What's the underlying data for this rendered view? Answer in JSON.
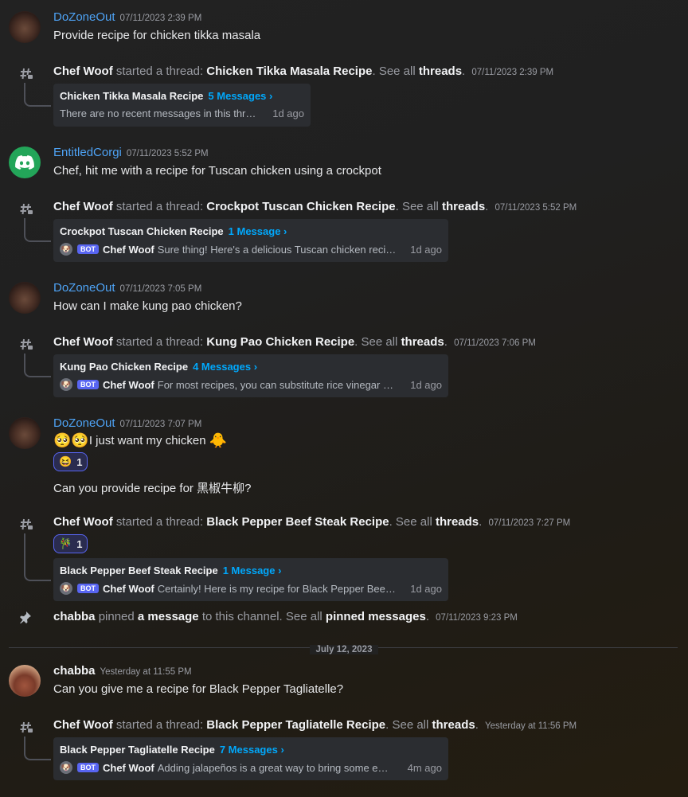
{
  "messages": [
    {
      "user": "DoZoneOut",
      "time": "07/11/2023 2:39 PM",
      "text": "Provide recipe for chicken tikka masala"
    },
    {
      "user": "EntitledCorgi",
      "time": "07/11/2023 5:52 PM",
      "text": "Chef, hit me with a recipe for Tuscan chicken using a crockpot"
    },
    {
      "user": "DoZoneOut",
      "time": "07/11/2023 7:05 PM",
      "text": "How can I make kung pao chicken?"
    },
    {
      "user": "DoZoneOut",
      "time": "07/11/2023 7:07 PM",
      "text": "I just want my chicken",
      "emoji_lead": "🥺🥺",
      "emoji_trail": "🐥",
      "reaction": {
        "emoji": "😆",
        "count": "1"
      },
      "text2": "Can you provide recipe for 黑椒牛柳?"
    },
    {
      "user": "chabba",
      "time": "Yesterday at 11:55 PM",
      "text": "Can you give me a recipe for Black Pepper Tagliatelle?"
    }
  ],
  "system": {
    "started": "started a thread:",
    "see_all": "See all",
    "threads_word": "threads",
    "pinned_verb": "pinned",
    "a_message": "a message",
    "to_channel": "to this channel. See all",
    "pinned_messages": "pinned messages",
    "bot_label": "BOT"
  },
  "threads": [
    {
      "starter": "Chef Woof",
      "name": "Chicken Tikka Masala Recipe",
      "time": "07/11/2023 2:39 PM",
      "count": "5 Messages ›",
      "preview_author": "",
      "preview": "There are no recent messages in this thread.",
      "ago": "1d ago"
    },
    {
      "starter": "Chef Woof",
      "name": "Crockpot Tuscan Chicken Recipe",
      "time": "07/11/2023 5:52 PM",
      "count": "1 Message ›",
      "preview_author": "Chef Woof",
      "preview": "Sure thing! Here's a delicious Tuscan chicken recipe for your crockpot",
      "ago": "1d ago"
    },
    {
      "starter": "Chef Woof",
      "name": "Kung Pao Chicken Recipe",
      "time": "07/11/2023 7:06 PM",
      "count": "4 Messages ›",
      "preview_author": "Chef Woof",
      "preview": "For most recipes, you can substitute rice vinegar with white wine vinegar",
      "ago": "1d ago"
    },
    {
      "starter": "Chef Woof",
      "name": "Black Pepper Beef Steak Recipe",
      "time": "07/11/2023 7:27 PM",
      "count": "1 Message ›",
      "preview_author": "Chef Woof",
      "preview": "Certainly! Here is my recipe for Black Pepper Beef Steak",
      "ago": "1d ago",
      "reaction": {
        "emoji": "🎋",
        "count": "1"
      }
    },
    {
      "starter": "Chef Woof",
      "name": "Black Pepper Tagliatelle Recipe",
      "time": "Yesterday at 11:56 PM",
      "count": "7 Messages ›",
      "preview_author": "Chef Woof",
      "preview": "Adding jalapeños is a great way to bring some extra heat",
      "ago": "4m ago"
    }
  ],
  "pin": {
    "user": "chabba",
    "time": "07/11/2023 9:23 PM"
  },
  "date_divider": "July 12, 2023",
  "colors": {
    "link_blue": "#4ea3f5",
    "thread_count": "#00a8fc",
    "bot_badge": "#5865f2",
    "card_bg": "#2b2d31"
  },
  "icons": {
    "thread": "thread-icon",
    "pin": "pin-icon",
    "discord": "discord-logo-icon"
  }
}
